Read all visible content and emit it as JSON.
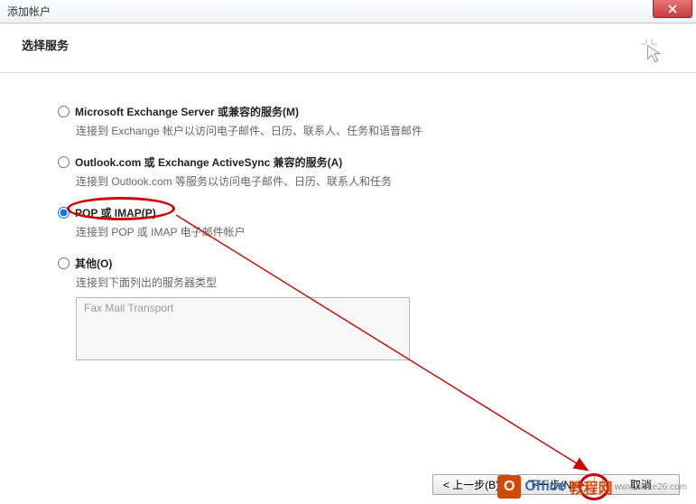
{
  "window": {
    "title": "添加帐户"
  },
  "header": {
    "title": "选择服务"
  },
  "options": [
    {
      "label": "Microsoft Exchange Server 或兼容的服务(M)",
      "desc": "连接到 Exchange 帐户以访问电子邮件、日历、联系人、任务和语音邮件"
    },
    {
      "label": "Outlook.com 或 Exchange ActiveSync 兼容的服务(A)",
      "desc": "连接到 Outlook.com 等服务以访问电子邮件、日历、联系人和任务"
    },
    {
      "label": "POP 或 IMAP(P)",
      "desc": "连接到 POP 或 IMAP 电子邮件帐户"
    },
    {
      "label": "其他(O)",
      "desc": "连接到下面列出的服务器类型"
    }
  ],
  "listbox": {
    "item": "Fax Mail Transport"
  },
  "buttons": {
    "back": "< 上一步(B)",
    "next": "下一步(N) >",
    "cancel": "取消"
  },
  "watermark": {
    "text1": "Office",
    "text2": "教程网",
    "sub": "www.office26.com",
    "logo": "O"
  },
  "annotation": {
    "highlighted_option": "POP 或 IMAP(P)",
    "arrow_target": "下一步(N) >"
  }
}
